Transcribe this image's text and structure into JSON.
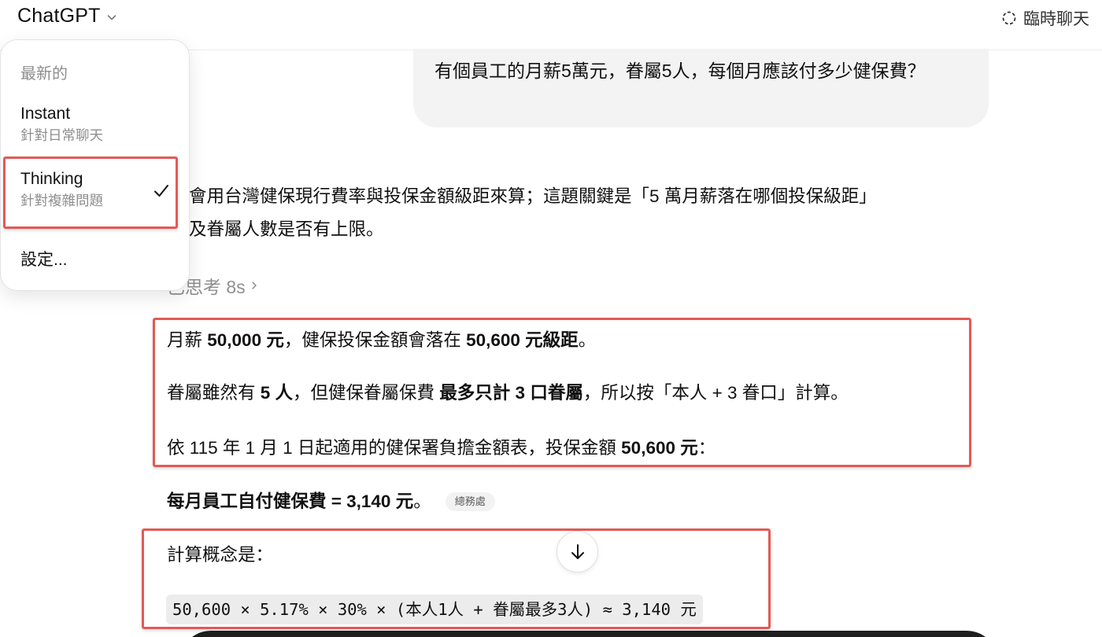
{
  "header": {
    "model_name": "ChatGPT",
    "temp_chat_label": "臨時聊天"
  },
  "dropdown": {
    "section_label": "最新的",
    "items": [
      {
        "title": "Instant",
        "subtitle": "針對日常聊天",
        "selected": false
      },
      {
        "title": "Thinking",
        "subtitle": "針對複雜問題",
        "selected": true
      }
    ],
    "settings_label": "設定..."
  },
  "user_message": "有個員工的月薪5萬元，眷屬5人，每個月應該付多少健保費？",
  "assistant": {
    "intro_line1": "會用台灣健保現行費率與投保金額級距來算；這題關鍵是「5 萬月薪落在哪個投保級距」",
    "intro_line2": "及眷屬人數是否有上限。",
    "thought_label": "已思考 8s",
    "p1": {
      "a": "月薪 ",
      "b1": "50,000 元",
      "c": "，健保投保金額會落在 ",
      "b2": "50,600 元級距",
      "d": "。"
    },
    "p2": {
      "a": "眷屬雖然有 ",
      "b1": "5 人",
      "c": "，但健保眷屬保費 ",
      "b2": "最多只計 3 口眷屬",
      "d": "，所以按「本人 + 3 眷口」計算。"
    },
    "p3": {
      "a": "依 115 年 1 月 1 日起適用的健保署負擔金額表，投保金額 ",
      "b1": "50,600 元",
      "c": "："
    },
    "p4": {
      "bold": "每月員工自付健保費 = 3,140 元",
      "tail": "。",
      "source": "總務處"
    },
    "p5": "計算概念是：",
    "formula": "50,600 × 5.17% × 30% × (本人1人 + 眷屬最多3人) ≈ 3,140 元"
  }
}
